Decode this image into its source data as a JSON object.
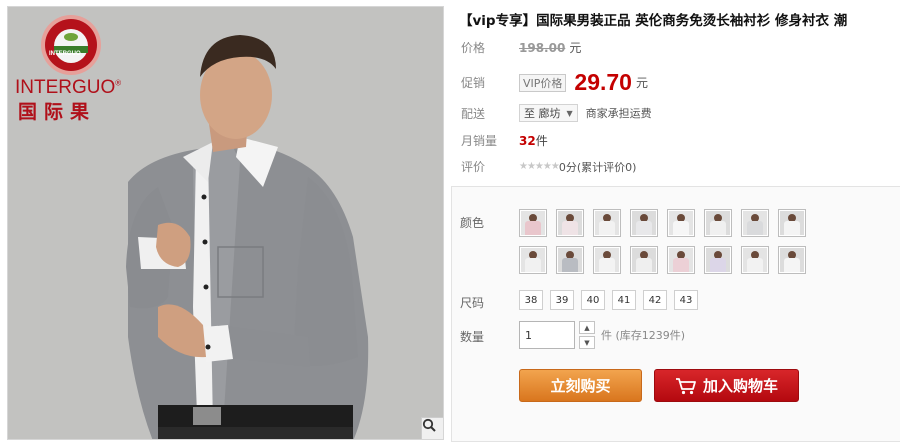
{
  "brand": {
    "logo_text": "INTERGUO",
    "name_en": "INTERGUO",
    "registered_mark": "®",
    "name_cn": "国际果"
  },
  "product": {
    "title": "【vip专享】国际果男装正品 英伦商务免烫长袖衬衫 修身衬衣 潮"
  },
  "price_row": {
    "label": "价格",
    "original": "198.00",
    "unit": "元"
  },
  "promo_row": {
    "label": "促销",
    "tag": "VIP价格",
    "price": "29.70",
    "unit": "元"
  },
  "shipping_row": {
    "label": "配送",
    "location": "至 廊坊",
    "note": "商家承担运费"
  },
  "sales_row": {
    "label": "月销量",
    "count": "32",
    "unit": "件"
  },
  "review_row": {
    "label": "评价",
    "stars_rating": 0,
    "stars_max": 5,
    "text": "0分(累计评价0)"
  },
  "sku": {
    "color_label": "颜色",
    "colors": [
      {
        "icon": "pink-shirt-swatch",
        "shirt": "#e9c6cc"
      },
      {
        "icon": "white-pink-shirt-swatch",
        "shirt": "#efe3e6"
      },
      {
        "icon": "white-shirt-swatch",
        "shirt": "#f2f2f2"
      },
      {
        "icon": "light-shirt-swatch",
        "shirt": "#e8e8ea"
      },
      {
        "icon": "white-dark-shirt-swatch",
        "shirt": "#f6f6f6"
      },
      {
        "icon": "white-shirt-swatch",
        "shirt": "#f0f0f0"
      },
      {
        "icon": "light-grey-shirt-swatch",
        "shirt": "#d9dadc"
      },
      {
        "icon": "white-shirt-swatch",
        "shirt": "#f4f4f4"
      },
      {
        "icon": "white-shirt-swatch",
        "shirt": "#f1f1f1"
      },
      {
        "icon": "grey-shirt-swatch",
        "shirt": "#b9bcc2"
      },
      {
        "icon": "white-shirt-swatch",
        "shirt": "#f3f3f3"
      },
      {
        "icon": "white-shirt-swatch",
        "shirt": "#efefef"
      },
      {
        "icon": "pink-shirt-swatch",
        "shirt": "#ecd0d6"
      },
      {
        "icon": "lavender-shirt-swatch",
        "shirt": "#dcd6e8"
      },
      {
        "icon": "white-shirt-swatch",
        "shirt": "#f2f2f2"
      },
      {
        "icon": "white-shirt-swatch",
        "shirt": "#f5f5f5"
      }
    ],
    "size_label": "尺码",
    "sizes": [
      "38",
      "39",
      "40",
      "41",
      "42",
      "43"
    ],
    "qty_label": "数量",
    "qty_value": "1",
    "qty_unit_stock": "件 (库存1239件)",
    "buy_now": "立刻购买",
    "add_to_cart": "加入购物车"
  },
  "colors": {
    "price_red": "#c40000",
    "buy_orange": "#e08a2e",
    "cart_red": "#c41218",
    "brand_red": "#b0101a"
  },
  "icons": {
    "zoom": "magnifier-icon",
    "cart": "shopping-cart-icon",
    "stepper_up": "triangle-up-icon",
    "stepper_down": "triangle-down-icon",
    "select_caret": "caret-down-icon"
  }
}
